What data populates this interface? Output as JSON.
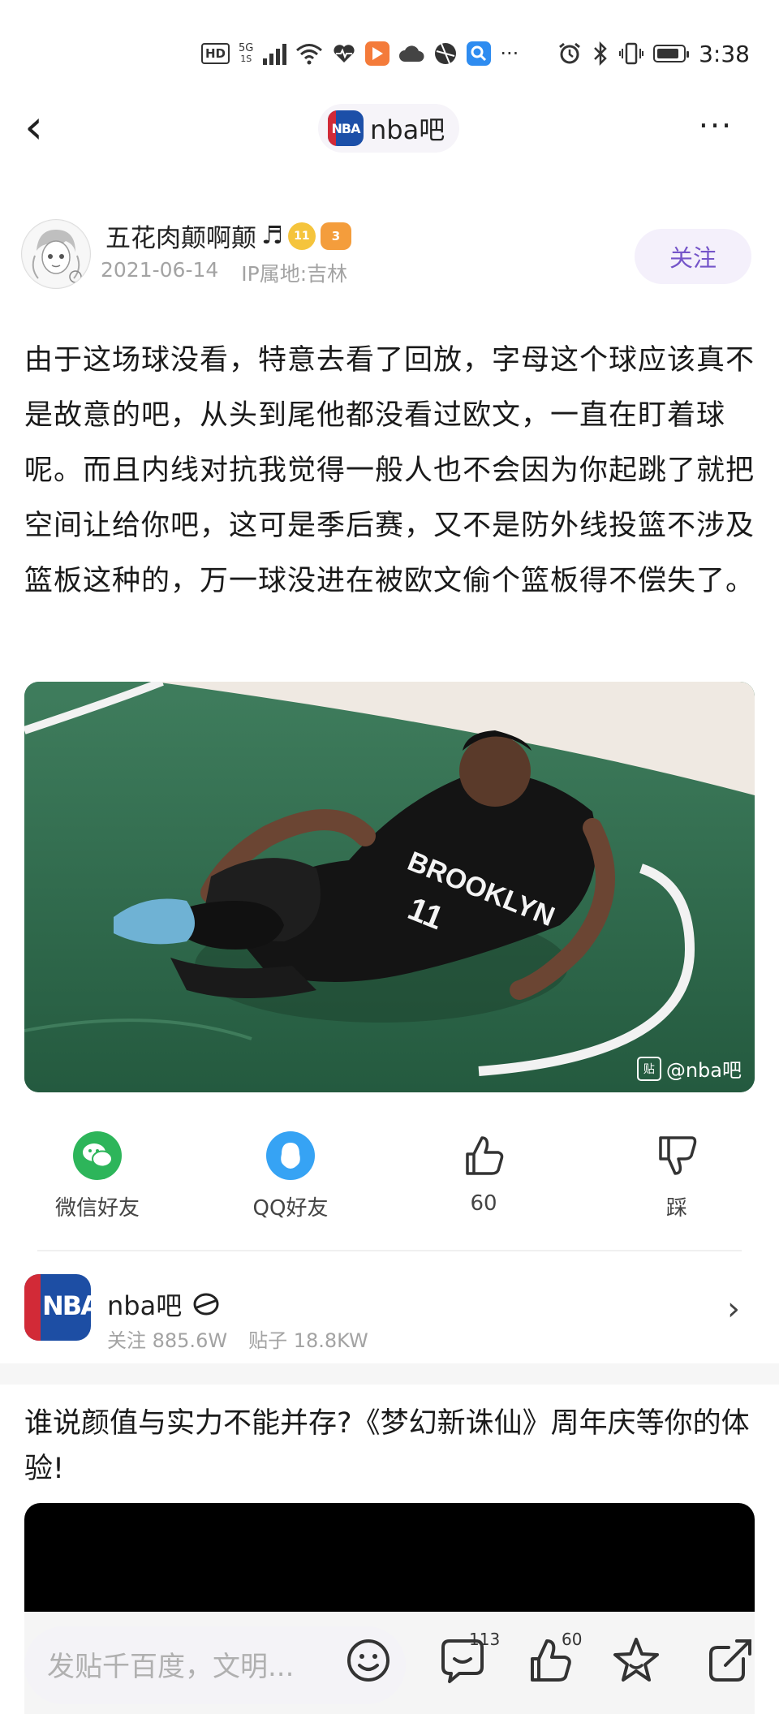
{
  "status_bar": {
    "hd": "HD",
    "network": "5G",
    "network_sub": "1S",
    "dots": "···",
    "time": "3:38",
    "battery_level": 0.85
  },
  "nav": {
    "back_symbol": "‹",
    "forum_badge": "NBA",
    "forum_name": "nba吧",
    "more_symbol": "···"
  },
  "author": {
    "name": "五花肉颠啊颠",
    "note_glyph": "♬",
    "level_badge": "11",
    "level_badge2": "3",
    "date": "2021-06-14",
    "ip_location": "IP属地:吉林",
    "follow_label": "关注"
  },
  "post": {
    "body": "由于这场球没看，特意去看了回放，字母这个球应该真不是故意的吧，从头到尾他都没看过欧文，一直在盯着球呢。而且内线对抗我觉得一般人也不会因为你起跳了就把空间让给你吧，这可是季后赛，又不是防外线投篮不涉及篮板这种的，万一球没进在被欧文偷个篮板得不偿失了。",
    "image_watermark": "@nba吧",
    "watermark_glyph": "贴",
    "jersey_text": "BROOKLYN",
    "jersey_number": "11"
  },
  "share": {
    "wechat_label": "微信好友",
    "qq_label": "QQ好友",
    "like_count": "60",
    "dislike_label": "踩"
  },
  "forum_card": {
    "logo_text": "NBA",
    "name": "nba吧",
    "followers": "关注 885.6W",
    "posts": "贴子 18.8KW",
    "chevron": "›"
  },
  "ad": {
    "title": "谁说颜值与实力不能并存?《梦幻新诛仙》周年庆等你的体验!"
  },
  "bottom_bar": {
    "reply_placeholder": "发贴千百度，文明...",
    "comment_count": "113",
    "like_count": "60"
  },
  "colors": {
    "accent": "#7555c9",
    "wechat": "#2db55a",
    "qq": "#36a3f4",
    "nba_blue": "#1d4ea4",
    "nba_red": "#d22a37"
  }
}
